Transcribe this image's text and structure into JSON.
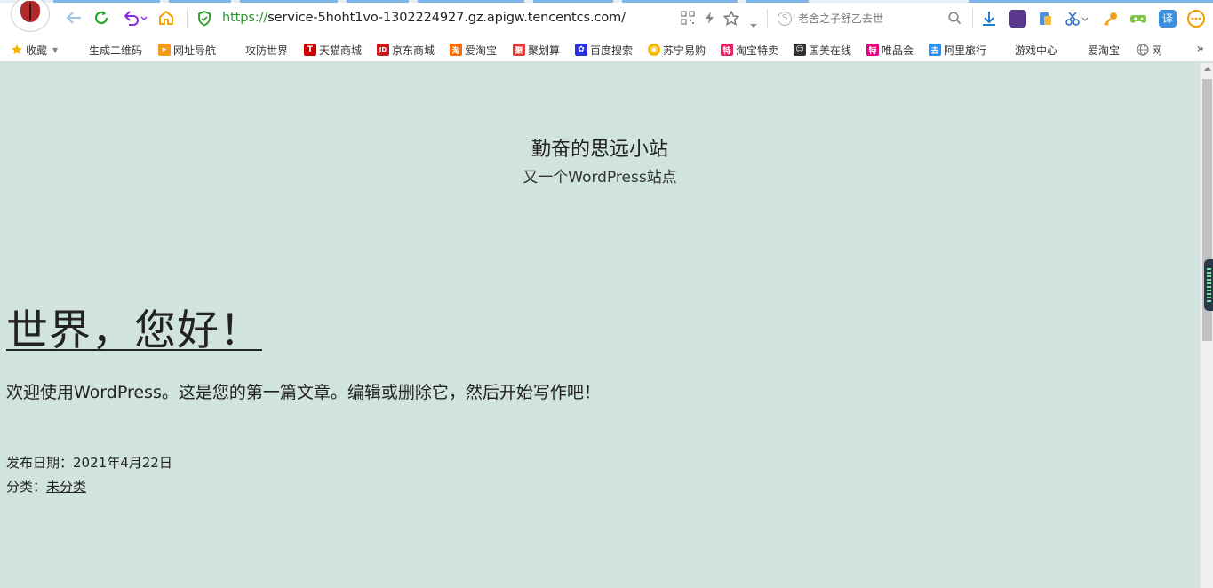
{
  "browser": {
    "url_protocol": "https://",
    "url_rest": "service-5hoht1vo-1302224927.gz.apigw.tencentcs.com/",
    "search_placeholder": "老舍之子舒乙去世",
    "colors": {
      "accent": "#2a9a2a",
      "refresh": "#22aa22",
      "undo": "#8a2be2",
      "home": "#f0a000",
      "download": "#1a7fd4"
    }
  },
  "bookmarks": [
    {
      "label": "收藏",
      "icon": "star-icon"
    },
    {
      "label": "生成二维码",
      "icon": "page-icon"
    },
    {
      "label": "网址导航",
      "icon": "nav-arrow-icon"
    },
    {
      "label": "攻防世界",
      "icon": "page-icon"
    },
    {
      "label": "天猫商城",
      "icon": "tmall-icon",
      "glyph": "T"
    },
    {
      "label": "京东商城",
      "icon": "jd-icon",
      "glyph": "JD"
    },
    {
      "label": "爱淘宝",
      "icon": "taobao-icon",
      "glyph": "淘"
    },
    {
      "label": "聚划算",
      "icon": "juhuasuan-icon",
      "glyph": "聚"
    },
    {
      "label": "百度搜索",
      "icon": "baidu-paw-icon"
    },
    {
      "label": "苏宁易购",
      "icon": "suning-icon"
    },
    {
      "label": "淘宝特卖",
      "icon": "taobao-sale-icon",
      "glyph": "特"
    },
    {
      "label": "国美在线",
      "icon": "gome-icon"
    },
    {
      "label": "唯品会",
      "icon": "vip-icon",
      "glyph": "特"
    },
    {
      "label": "阿里旅行",
      "icon": "ali-travel-icon",
      "glyph": "去"
    },
    {
      "label": "游戏中心",
      "icon": "page-icon"
    },
    {
      "label": "爱淘宝",
      "icon": "page-icon"
    },
    {
      "label": "网",
      "icon": "globe-icon"
    }
  ],
  "site": {
    "title": "勤奋的思远小站",
    "description": "又一个WordPress站点"
  },
  "post": {
    "title": "世界，您好！",
    "body": "欢迎使用WordPress。这是您的第一篇文章。编辑或删除它，然后开始写作吧！",
    "date_label": "发布日期：",
    "date_value": "2021年4月22日",
    "category_label": "分类：",
    "category_value": "未分类"
  }
}
